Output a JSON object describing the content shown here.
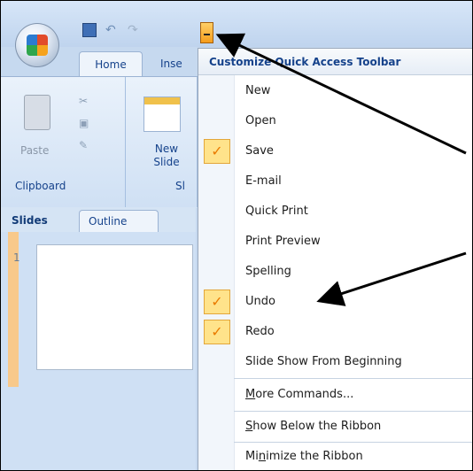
{
  "ribbon": {
    "tabs": {
      "home": "Home",
      "insert": "Inse"
    },
    "clipboard": {
      "paste_label": "Paste",
      "group_label": "Clipboard"
    },
    "slides": {
      "new_slide_line1": "New",
      "new_slide_line2": "Slide",
      "group_label": "Sl"
    }
  },
  "side_pane": {
    "tabs": {
      "slides": "Slides",
      "outline": "Outline"
    },
    "slide_number": "1"
  },
  "menu": {
    "title": "Customize Quick Access Toolbar",
    "items": [
      {
        "label": "New",
        "checked": false
      },
      {
        "label": "Open",
        "checked": false
      },
      {
        "label": "Save",
        "checked": true
      },
      {
        "label": "E-mail",
        "checked": false
      },
      {
        "label": "Quick Print",
        "checked": false
      },
      {
        "label": "Print Preview",
        "checked": false
      },
      {
        "label": "Spelling",
        "checked": false
      },
      {
        "label": "Undo",
        "checked": true
      },
      {
        "label": "Redo",
        "checked": true
      },
      {
        "label": "Slide Show From Beginning",
        "checked": false
      }
    ],
    "more_commands": {
      "mnemonic": "M",
      "rest": "ore Commands..."
    },
    "show_below": {
      "mnemonic": "S",
      "rest": "how Below the Ribbon"
    },
    "minimize": {
      "before": "Mi",
      "mnemonic": "n",
      "after": "imize the Ribbon"
    }
  },
  "colors": {
    "accent_blue": "#15428b",
    "checkmark_orange": "#ea7b00",
    "check_bg": "#ffe38b",
    "menu_bg": "#ffffff",
    "ribbon_bg": "#cfe0f4"
  },
  "icons": [
    "office-button-icon",
    "save-icon",
    "undo-icon",
    "redo-icon",
    "customize-dropdown-icon",
    "paste-icon",
    "cut-icon",
    "copy-icon",
    "format-painter-icon",
    "new-slide-icon",
    "checkmark-icon"
  ]
}
